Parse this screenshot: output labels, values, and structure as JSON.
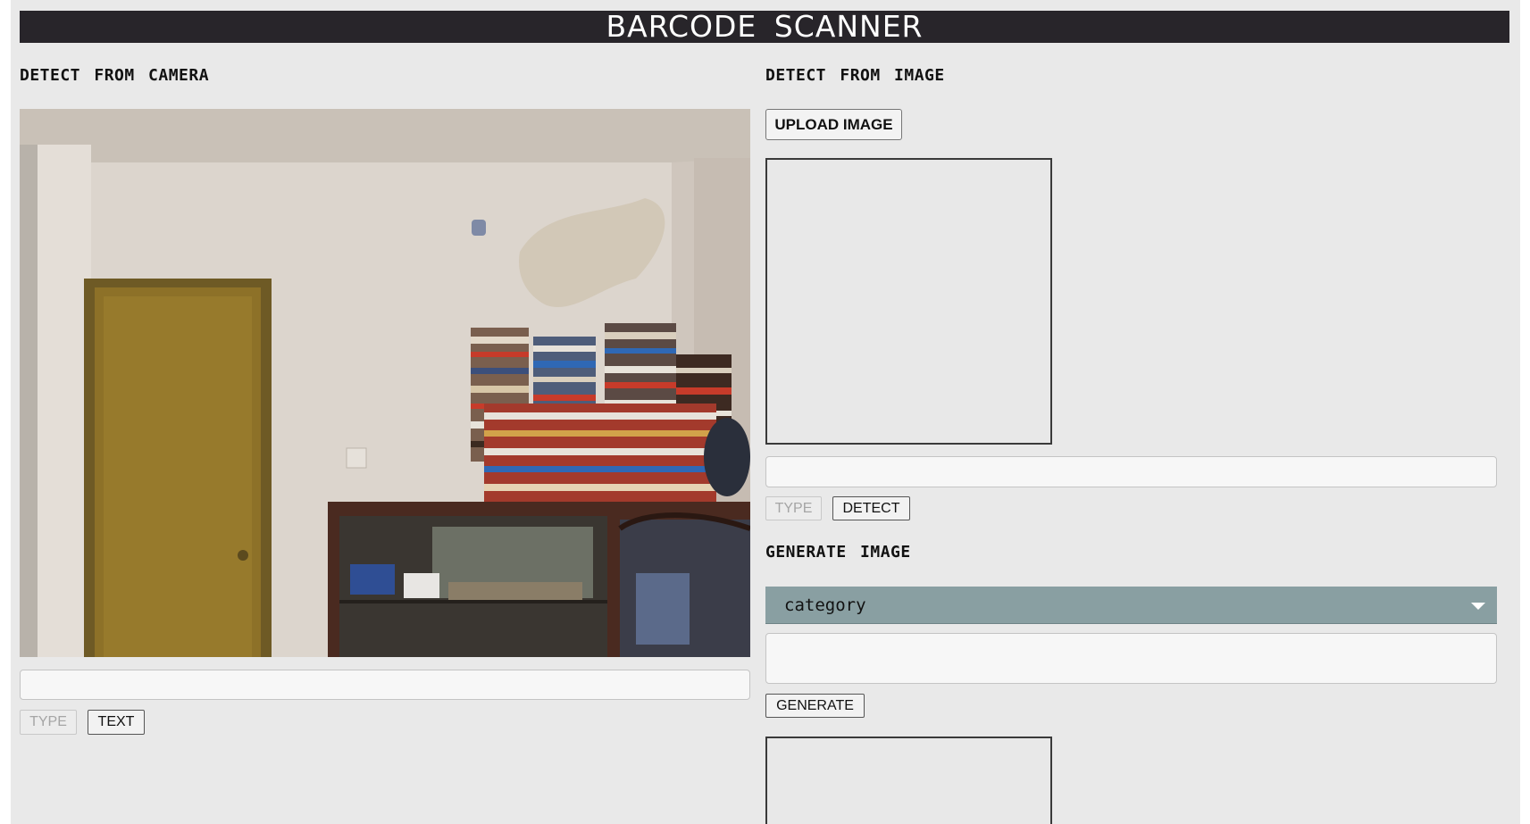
{
  "app": {
    "title": "BARCODE SCANNER"
  },
  "camera_section": {
    "heading": "DETECT FROM CAMERA",
    "result_value": "",
    "type_button": "TYPE",
    "text_button": "TEXT"
  },
  "image_section": {
    "heading": "DETECT FROM IMAGE",
    "upload_button": "UPLOAD IMAGE",
    "result_value": "",
    "type_button": "TYPE",
    "detect_button": "DETECT"
  },
  "generate_section": {
    "heading": "GENERATE IMAGE",
    "category_select": {
      "selected": "category"
    },
    "input_value": "",
    "generate_button": "GENERATE"
  },
  "colors": {
    "title_bar": "#28252a",
    "page_background": "#e9e9e9",
    "select_background": "#899fa2"
  }
}
